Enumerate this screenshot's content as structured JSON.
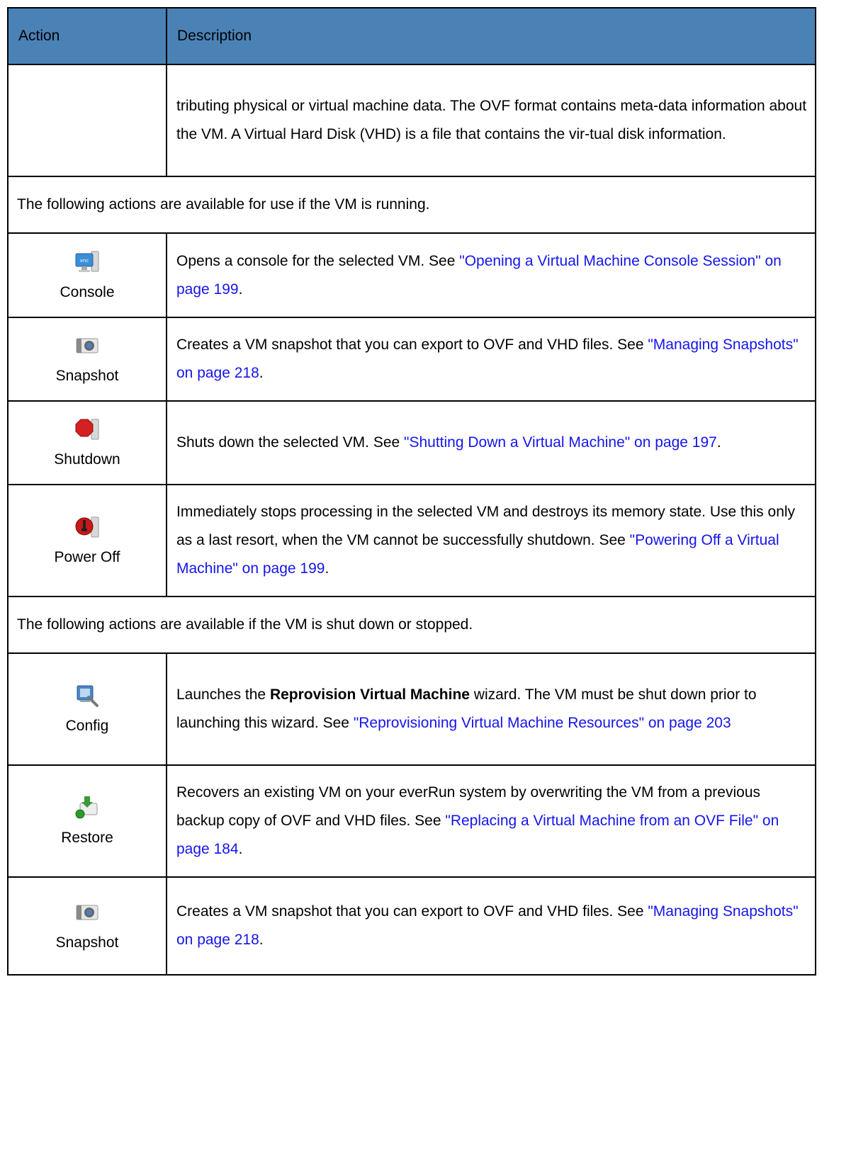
{
  "header": {
    "action": "Action",
    "description": "Description"
  },
  "first_row_text": "tributing physical or virtual machine data. The OVF format contains meta-data information about the VM. A Virtual Hard Disk (VHD) is a file that contains the vir-tual disk information.",
  "running_note": "The following actions are available for use if the VM is running.",
  "stopped_note": "The following actions are available if the VM is shut down or stopped.",
  "colors": {
    "header_bg": "#4a82b6",
    "link": "#1515ee",
    "border": "#000000"
  },
  "running_actions": [
    {
      "icon": "vnc-console-icon",
      "label": "Console",
      "text": "Opens a console for the selected VM. See ",
      "link": "\"Opening a Virtual Machine Console Session\" on page 199",
      "after": "."
    },
    {
      "icon": "camera-snapshot-icon",
      "label": "Snapshot",
      "text": "Creates a VM snapshot that you can export to OVF and VHD files. See ",
      "link": "\"Managing Snapshots\" on page 218",
      "after": "."
    },
    {
      "icon": "stop-sign-icon",
      "label": "Shutdown",
      "text": "Shuts down the selected VM. See ",
      "link": "\"Shutting Down a Virtual Machine\" on page 197",
      "after": "."
    },
    {
      "icon": "power-plug-icon",
      "label": "Power Off",
      "text": "Immediately stops processing in the selected VM and destroys its memory state. Use this only as a last resort, when the VM cannot be successfully shutdown. See ",
      "link": "\"Powering Off a Virtual Machine\" on page 199",
      "after": "."
    }
  ],
  "stopped_actions": [
    {
      "icon": "config-wrench-icon",
      "label": "Config",
      "before": "Launches the ",
      "bold": "Reprovision Virtual Machine",
      "text": " wizard. The VM must be shut down prior to launching this wizard. See ",
      "link": "\"Reprovisioning Virtual Machine Resources\" on page 203",
      "after": ""
    },
    {
      "icon": "restore-download-icon",
      "label": "Restore",
      "text": "Recovers an existing VM on your everRun system by overwriting the VM from a previous backup copy of OVF and VHD files. See ",
      "link": "\"Replacing a Virtual Machine from an OVF File\" on page 184",
      "after": "."
    },
    {
      "icon": "camera-snapshot-icon",
      "label": "Snapshot",
      "text": "Creates a VM snapshot that you can export to OVF and VHD files. See ",
      "link": "\"Managing Snapshots\" on page 218",
      "after": "."
    }
  ]
}
